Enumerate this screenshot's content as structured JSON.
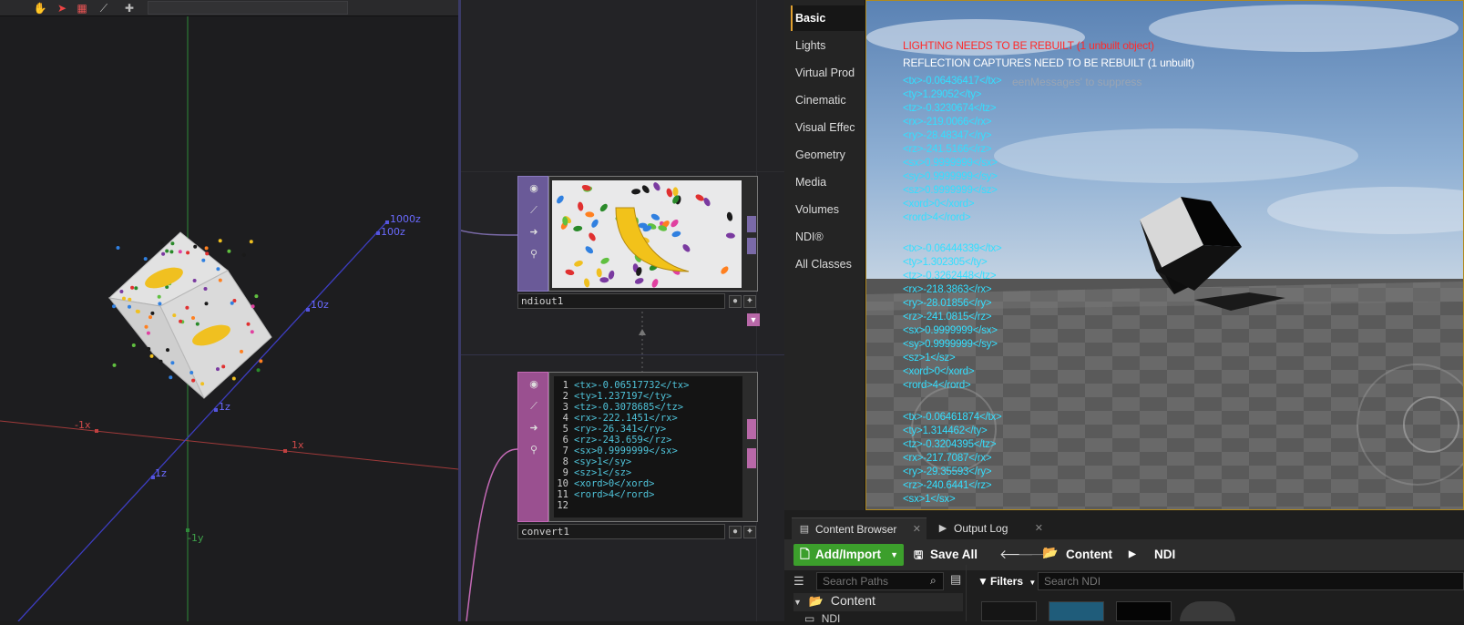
{
  "viewport3d": {
    "axis_labels": {
      "z_1000": "1000z",
      "z_100": "100z",
      "z_10": "10z",
      "z_1": "1z",
      "z_neg1": "1z",
      "x_neg1": "-1x",
      "x_1": "1x",
      "y_neg1": "-1y"
    }
  },
  "network": {
    "nodes": [
      {
        "name": "ndiout1",
        "kind": "TOP"
      },
      {
        "name": "convert1",
        "kind": "DAT"
      }
    ],
    "convert1_lines": [
      {
        "n": "1",
        "text": "<tx>-0.06517732</tx>"
      },
      {
        "n": "2",
        "text": "<ty>1.237197</ty>"
      },
      {
        "n": "3",
        "text": "<tz>-0.3078685</tz>"
      },
      {
        "n": "4",
        "text": "<rx>-222.1451</rx>"
      },
      {
        "n": "5",
        "text": "<ry>-26.341</ry>"
      },
      {
        "n": "6",
        "text": "<rz>-243.659</rz>"
      },
      {
        "n": "7",
        "text": "<sx>0.9999999</sx>"
      },
      {
        "n": "8",
        "text": "<sy>1</sy>"
      },
      {
        "n": "9",
        "text": "<sz>1</sz>"
      },
      {
        "n": "10",
        "text": "<xord>0</xord>"
      },
      {
        "n": "11",
        "text": "<rord>4</rord>"
      },
      {
        "n": "12",
        "text": ""
      }
    ]
  },
  "place_panel": {
    "items": [
      "Basic",
      "Lights",
      "Virtual Prod",
      "Cinematic",
      "Visual Effec",
      "Geometry",
      "Media",
      "Volumes",
      "NDI®",
      "All Classes"
    ],
    "active": "Basic"
  },
  "ue_viewport": {
    "lighting_msg": "LIGHTING NEEDS TO BE REBUILT (1 unbuilt object)",
    "reflection_msg": "REFLECTION CAPTURES NEED TO BE REBUILT (1 unbuilt)",
    "suppress_msg": "eenMessages' to suppress",
    "xform_blocks": [
      [
        "<tx>-0.06436417</tx>",
        "<ty>1.29052</ty>",
        "<tz>-0.3230674</tz>",
        "<rx>-219.0066</rx>",
        "<ry>-28.48347</ry>",
        "<rz>-241.5166</rz>",
        "<sx>0.9999999</sx>",
        "<sy>0.9999999</sy>",
        "<sz>0.9999999</sz>",
        "<xord>0</xord>",
        "<rord>4</rord>"
      ],
      [
        "<tx>-0.06444339</tx>",
        "<ty>1.302305</ty>",
        "<tz>-0.3262448</tz>",
        "<rx>-218.3863</rx>",
        "<ry>-28.01856</ry>",
        "<rz>-241.0815</rz>",
        "<sx>0.9999999</sx>",
        "<sy>0.9999999</sy>",
        "<sz>1</sz>",
        "<xord>0</xord>",
        "<rord>4</rord>"
      ],
      [
        "<tx>-0.06461874</tx>",
        "<ty>1.314462</ty>",
        "<tz>-0.3204395</tz>",
        "<rx>-217.7087</rx>",
        "<ry>-29.35593</ry>",
        "<rz>-240.6441</rz>",
        "<sx>1</sx>"
      ]
    ]
  },
  "content_browser": {
    "tabs": [
      "Content Browser",
      "Output Log"
    ],
    "add_import": "Add/Import",
    "save_all": "Save All",
    "breadcrumbs": [
      "Content",
      "NDI"
    ],
    "search_paths_placeholder": "Search Paths",
    "filters": "Filters",
    "search_ndi_placeholder": "Search NDI",
    "tree_root": "Content",
    "tree_child": "NDI"
  },
  "colors": {
    "accent_orange": "#e0a030",
    "add_green": "#3c9f2c",
    "xform_cyan": "#33dfff",
    "warn_red": "#ff2a2a",
    "ndi_node": "#7a6aa8",
    "dat_node": "#b868a8"
  }
}
